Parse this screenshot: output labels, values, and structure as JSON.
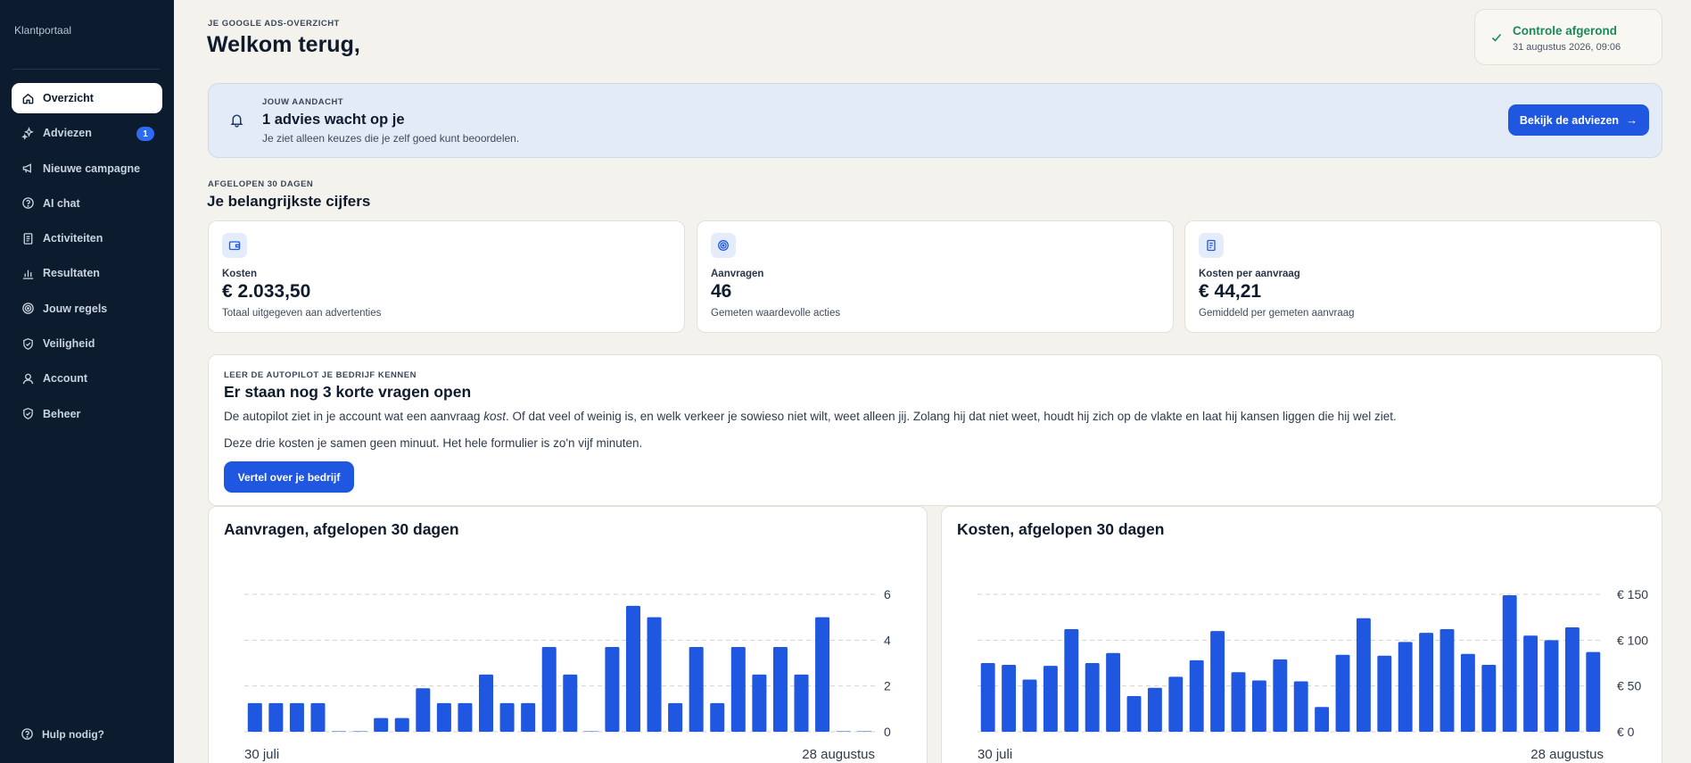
{
  "sidebar": {
    "portal_label": "Klantportaal",
    "items": [
      {
        "label": "Overzicht",
        "icon": "home-icon",
        "active": true
      },
      {
        "label": "Adviezen",
        "icon": "sparkle-icon",
        "badge": "1"
      },
      {
        "label": "Nieuwe campagne",
        "icon": "megaphone-icon"
      },
      {
        "label": "AI chat",
        "icon": "question-icon"
      },
      {
        "label": "Activiteiten",
        "icon": "document-icon"
      },
      {
        "label": "Resultaten",
        "icon": "bar-chart-icon"
      },
      {
        "label": "Jouw regels",
        "icon": "target-icon"
      },
      {
        "label": "Veiligheid",
        "icon": "shield-check-icon"
      },
      {
        "label": "Account",
        "icon": "user-icon"
      },
      {
        "label": "Beheer",
        "icon": "shield-check-icon"
      }
    ],
    "help_label": "Hulp nodig?"
  },
  "header": {
    "eyebrow": "JE GOOGLE ADS-OVERZICHT",
    "title": "Welkom terug,"
  },
  "status": {
    "title": "Controle afgerond",
    "timestamp": "31 augustus 2026, 09:06",
    "color": "#1b8a5a"
  },
  "banner": {
    "eyebrow": "JOUW AANDACHT",
    "title": "1 advies wacht op je",
    "subtitle": "Je ziet alleen keuzes die je zelf goed kunt beoordelen.",
    "button_label": "Bekijk de adviezen"
  },
  "metrics": {
    "eyebrow": "AFGELOPEN 30 DAGEN",
    "title": "Je belangrijkste cijfers",
    "cards": [
      {
        "icon": "wallet-icon",
        "label": "Kosten",
        "value": "€ 2.033,50",
        "sub": "Totaal uitgegeven aan advertenties"
      },
      {
        "icon": "target-icon",
        "label": "Aanvragen",
        "value": "46",
        "sub": "Gemeten waardevolle acties"
      },
      {
        "icon": "receipt-icon",
        "label": "Kosten per aanvraag",
        "value": "€ 44,21",
        "sub": "Gemiddeld per gemeten aanvraag"
      }
    ]
  },
  "learn": {
    "eyebrow": "LEER DE AUTOPILOT JE BEDRIJF KENNEN",
    "title": "Er staan nog 3 korte vragen open",
    "p1_before": "De autopilot ziet in je account wat een aanvraag ",
    "p1_em": "kost",
    "p1_after": ". Of dat veel of weinig is, en welk verkeer je sowieso niet wilt, weet alleen jij. Zolang hij dat niet weet, houdt hij zich op de vlakte en laat hij kansen liggen die hij wel ziet.",
    "p2": "Deze drie kosten je samen geen minuut. Het hele formulier is zo'n vijf minuten.",
    "button_label": "Vertel over je bedrijf"
  },
  "accent_color": "#1f57e0",
  "chart_data": [
    {
      "type": "bar",
      "title": "Aanvragen, afgelopen 30 dagen",
      "x_start_label": "30 juli",
      "x_end_label": "28 augustus",
      "yticks": [
        "0",
        "2",
        "4",
        "6"
      ],
      "ylim": [
        0,
        6
      ],
      "grid": true,
      "values": [
        1.25,
        1.25,
        1.25,
        1.25,
        0,
        0,
        0.6,
        0.6,
        1.9,
        1.25,
        1.25,
        2.5,
        1.25,
        1.25,
        3.7,
        2.5,
        0,
        3.7,
        5.5,
        5.0,
        1.25,
        3.7,
        1.25,
        3.7,
        2.5,
        3.7,
        2.5,
        5.0,
        0,
        0
      ]
    },
    {
      "type": "bar",
      "title": "Kosten, afgelopen 30 dagen",
      "x_start_label": "30 juli",
      "x_end_label": "28 augustus",
      "yticks": [
        "€ 0",
        "€ 50",
        "€ 100",
        "€ 150"
      ],
      "ylim": [
        0,
        150
      ],
      "grid": true,
      "values": [
        75,
        73,
        57,
        72,
        112,
        75,
        86,
        39,
        48,
        60,
        78,
        110,
        65,
        56,
        79,
        55,
        27,
        84,
        124,
        83,
        98,
        108,
        112,
        85,
        73,
        149,
        105,
        100,
        114,
        87
      ]
    }
  ]
}
